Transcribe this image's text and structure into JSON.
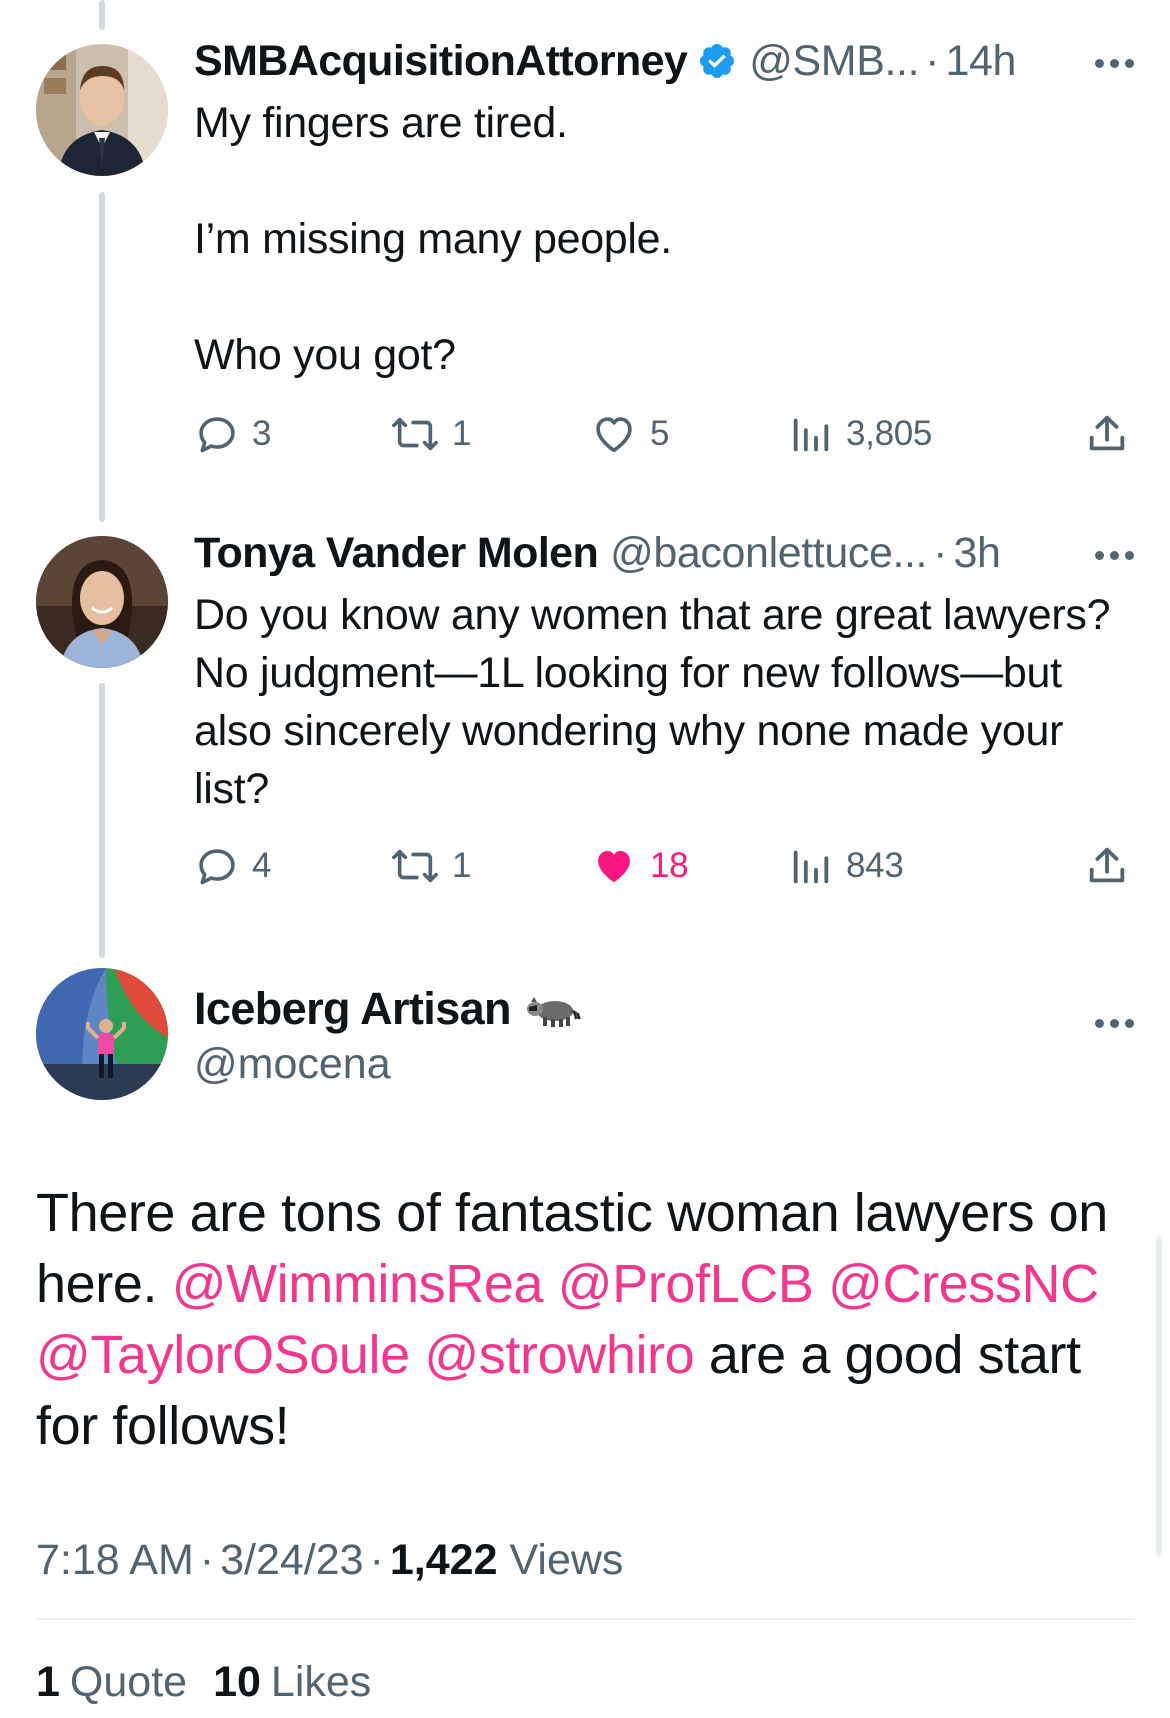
{
  "thread": [
    {
      "display_name": "SMBAcquisitionAttorney",
      "verified": true,
      "handle": "@SMB...",
      "time": "14h",
      "text": "My fingers are tired.\n\nI’m missing many people.\n\nWho you got?",
      "actions": {
        "replies": "3",
        "retweets": "1",
        "likes": "5",
        "views": "3,805",
        "liked": false
      },
      "avatar": "man-in-suit-photo"
    },
    {
      "display_name": "Tonya Vander Molen",
      "verified": false,
      "handle": "@baconlettuce...",
      "time": "3h",
      "text": "Do you know any women that are great lawyers? No judgment—1L looking for new follows—but also sincerely wondering why none made your list?",
      "actions": {
        "replies": "4",
        "retweets": "1",
        "likes": "18",
        "views": "843",
        "liked": true
      },
      "avatar": "woman-smiling-photo"
    }
  ],
  "main_tweet": {
    "display_name": "Iceberg Artisan",
    "emoji": "raccoon",
    "handle": "@mocena",
    "text_parts": {
      "p1": "There are tons of fantastic woman lawyers on here. ",
      "m1": "@WimminsRea",
      "m2": "@ProfLCB",
      "m3": "@CressNC",
      "m4": "@TaylorOSoule",
      "m5": "@strowhiro",
      "p2": " are a good start for follows!"
    },
    "time": "7:18 AM",
    "date": "3/24/23",
    "views_count": "1,422",
    "views_label": "Views",
    "quotes_count": "1",
    "quotes_label": "Quote",
    "likes_count": "10",
    "likes_label": "Likes",
    "avatar": "person-flexing-photo"
  },
  "colors": {
    "accent_mention": "#f0388f",
    "like_active": "#f91880",
    "verified": "#1d9bf0",
    "muted": "#536471",
    "thread_line": "#cfd9de"
  },
  "separator": "·"
}
